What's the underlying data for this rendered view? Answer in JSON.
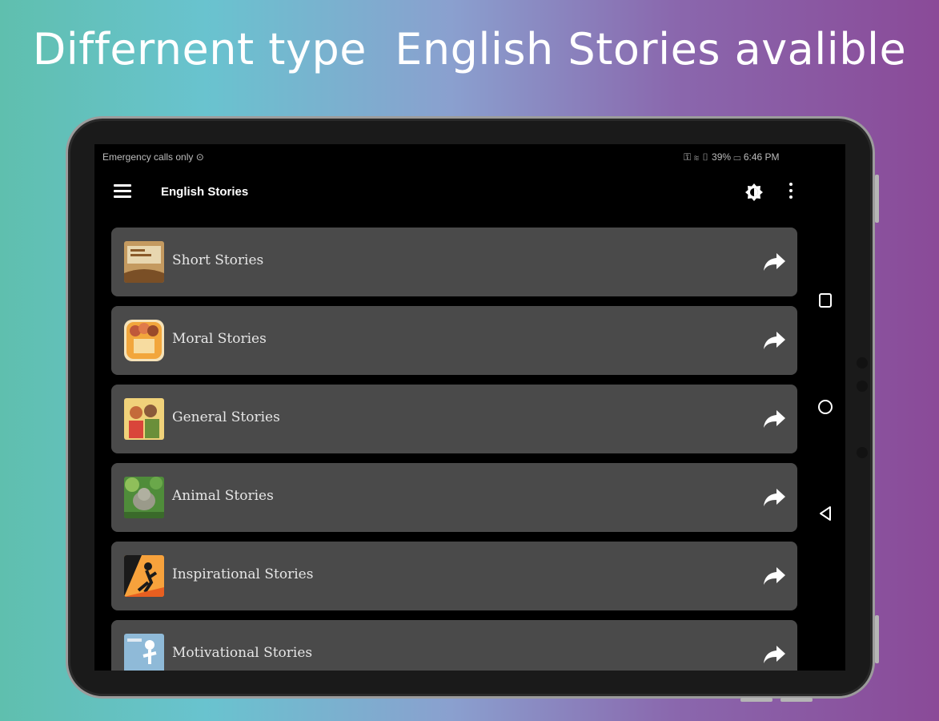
{
  "headline": "Differnent type  English Stories avalible",
  "status_bar": {
    "left_text": "Emergency calls only ⊙",
    "right_text": "⚿ ≋ ▯ 39% ▭ 6:46 PM"
  },
  "app_bar": {
    "title": "English Stories",
    "menu_icon": "hamburger-menu-icon",
    "theme_icon": "brightness-icon",
    "more_icon": "more-vert-icon"
  },
  "categories": [
    {
      "label": "Short Stories",
      "thumb_colors": [
        "#b8864e",
        "#e8d7b0"
      ]
    },
    {
      "label": "Moral Stories",
      "thumb_colors": [
        "#f2a63c",
        "#f7dca0"
      ]
    },
    {
      "label": "General Stories",
      "thumb_colors": [
        "#e0b23a",
        "#6a8f3a"
      ]
    },
    {
      "label": "Animal Stories",
      "thumb_colors": [
        "#4f8c3a",
        "#8fbf5a"
      ]
    },
    {
      "label": "Inspirational Stories",
      "thumb_colors": [
        "#e85f20",
        "#1a1a1a"
      ]
    },
    {
      "label": "Motivational Stories",
      "thumb_colors": [
        "#8fbad8",
        "#dfe9f2"
      ]
    }
  ],
  "colors": {
    "card_background": "#4a4a4a",
    "screen_background": "#000000",
    "text": "#e6e6e6"
  }
}
